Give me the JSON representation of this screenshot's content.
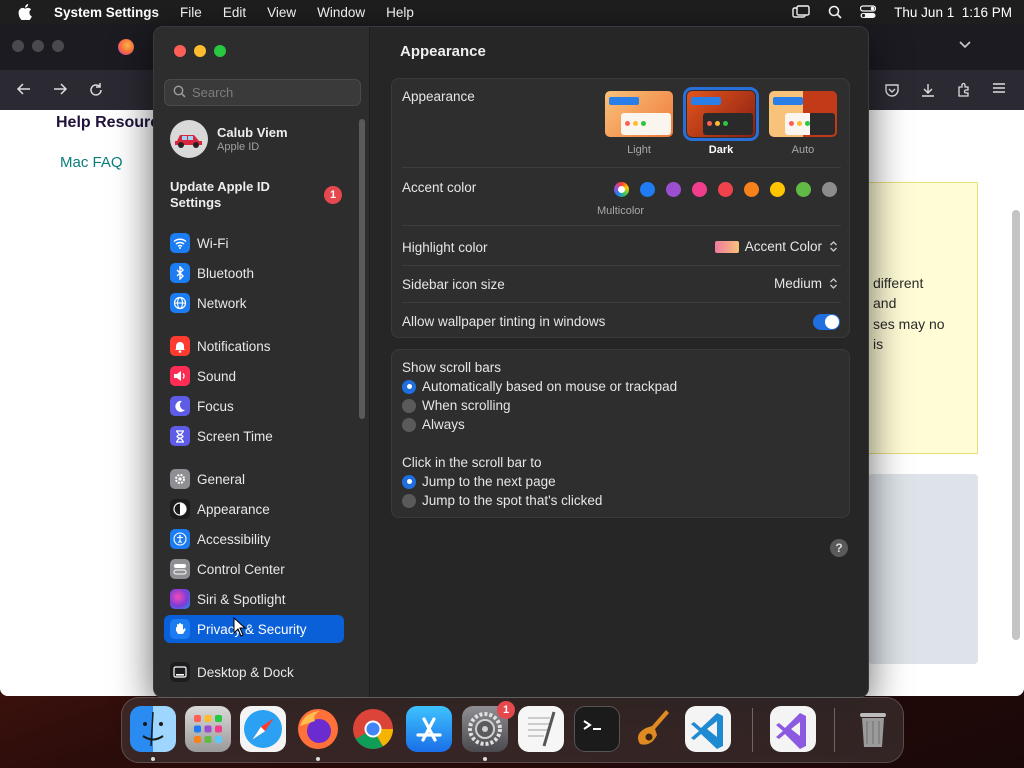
{
  "menubar": {
    "app_name": "System Settings",
    "items": [
      "File",
      "Edit",
      "View",
      "Window",
      "Help"
    ],
    "clock": "Thu Jun 1  1:16 PM"
  },
  "browser": {
    "help_title": "Help Resourc",
    "faq_link": "Mac FAQ",
    "note_lines": [
      "different",
      "and",
      "ses may no",
      "is"
    ]
  },
  "sidebar": {
    "search_placeholder": "Search",
    "profile": {
      "name": "Calub Viem",
      "subtitle": "Apple ID"
    },
    "update": {
      "label": "Update Apple ID Settings",
      "badge": "1"
    },
    "items": [
      {
        "label": "Wi-Fi",
        "icon": "wifi-icon",
        "color": "#1c7cf2"
      },
      {
        "label": "Bluetooth",
        "icon": "bluetooth-icon",
        "color": "#1c7cf2"
      },
      {
        "label": "Network",
        "icon": "globe-icon",
        "color": "#1c7cf2"
      },
      {
        "label": "Notifications",
        "icon": "bell-icon",
        "color": "#ff3b30"
      },
      {
        "label": "Sound",
        "icon": "speaker-icon",
        "color": "#ff2d55"
      },
      {
        "label": "Focus",
        "icon": "moon-icon",
        "color": "#5e5ce6"
      },
      {
        "label": "Screen Time",
        "icon": "hourglass-icon",
        "color": "#5e5ce6"
      },
      {
        "label": "General",
        "icon": "gear-icon",
        "color": "#8e8e93"
      },
      {
        "label": "Appearance",
        "icon": "appearance-icon",
        "color": "#1c1c1e"
      },
      {
        "label": "Accessibility",
        "icon": "accessibility-icon",
        "color": "#1c7cf2"
      },
      {
        "label": "Control Center",
        "icon": "control-center-icon",
        "color": "#8e8e93"
      },
      {
        "label": "Siri & Spotlight",
        "icon": "siri-icon",
        "color": "#7a3cd8"
      },
      {
        "label": "Privacy & Security",
        "icon": "hand-icon",
        "color": "#1c7cf2",
        "selected": true
      },
      {
        "label": "Desktop & Dock",
        "icon": "dock-icon",
        "color": "#1c1c1e"
      }
    ]
  },
  "pane": {
    "title": "Appearance",
    "appearance": {
      "label": "Appearance",
      "options": [
        {
          "label": "Light",
          "selected": false
        },
        {
          "label": "Dark",
          "selected": true
        },
        {
          "label": "Auto",
          "selected": false
        }
      ]
    },
    "accent": {
      "label": "Accent color",
      "multicolor_label": "Multicolor",
      "colors": [
        "#ffffff",
        "#1f7cf2",
        "#9b4fd0",
        "#f03e8c",
        "#f0424b",
        "#f7821b",
        "#ffc600",
        "#62ba46",
        "#8c8c8c"
      ]
    },
    "highlight": {
      "label": "Highlight color",
      "value": "Accent Color"
    },
    "sidebar_icon": {
      "label": "Sidebar icon size",
      "value": "Medium"
    },
    "tinting": {
      "label": "Allow wallpaper tinting in windows",
      "on": true
    },
    "scrollbars": {
      "label": "Show scroll bars",
      "options": [
        {
          "label": "Automatically based on mouse or trackpad",
          "selected": true
        },
        {
          "label": "When scrolling",
          "selected": false
        },
        {
          "label": "Always",
          "selected": false
        }
      ]
    },
    "click_scroll": {
      "label": "Click in the scroll bar to",
      "options": [
        {
          "label": "Jump to the next page",
          "selected": true
        },
        {
          "label": "Jump to the spot that's clicked",
          "selected": false
        }
      ]
    },
    "help": "?"
  },
  "dock": {
    "settings_badge": "1",
    "apps": [
      "finder-icon",
      "launchpad-icon",
      "safari-icon",
      "firefox-icon",
      "chrome-icon",
      "app-store-icon",
      "system-settings-icon",
      "textedit-icon",
      "terminal-icon",
      "garageband-icon",
      "vscode-icon",
      "visual-studio-icon",
      "trash-icon"
    ]
  }
}
